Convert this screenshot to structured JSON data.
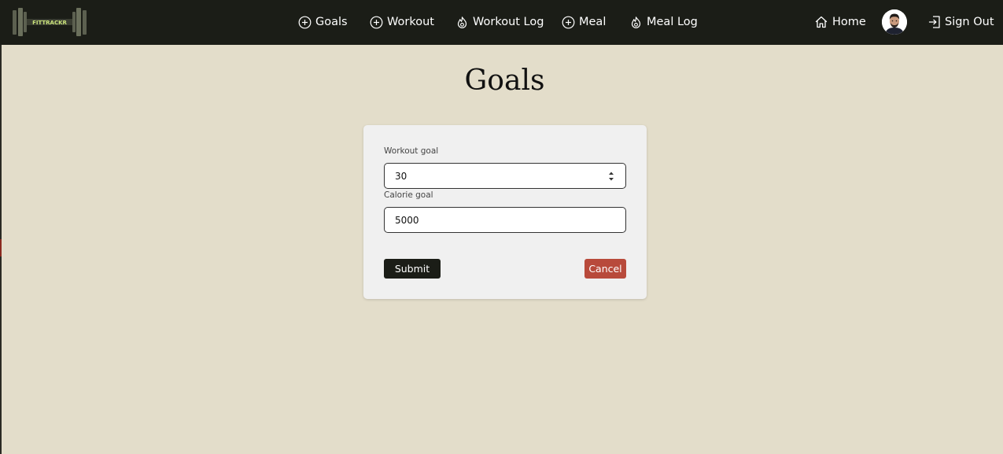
{
  "brand": {
    "logo_text": "FITTRACKR"
  },
  "nav": {
    "items": [
      {
        "label": "Goals",
        "icon": "plus-circle-icon"
      },
      {
        "label": "Workout",
        "icon": "plus-circle-icon"
      },
      {
        "label": "Workout Log",
        "icon": "flame-icon"
      },
      {
        "label": "Meal",
        "icon": "plus-circle-icon"
      },
      {
        "label": "Meal Log",
        "icon": "flame-icon"
      }
    ],
    "home_label": "Home",
    "home_icon": "home-icon",
    "avatar_icon": "user-avatar",
    "signout_label": "Sign Out",
    "signout_icon": "sign-out-icon"
  },
  "page": {
    "title": "Goals"
  },
  "form": {
    "workout_goal_label": "Workout goal",
    "workout_goal_value": "30",
    "calorie_goal_label": "Calorie goal",
    "calorie_goal_value": "5000",
    "submit_label": "Submit",
    "cancel_label": "Cancel"
  },
  "colors": {
    "navbar_bg": "#1b1d17",
    "page_bg": "#e3ddca",
    "card_bg": "#f0f0f0",
    "submit_bg": "#1b1d17",
    "cancel_bg": "#b84a3b",
    "logo_accent": "#c9e27a"
  }
}
